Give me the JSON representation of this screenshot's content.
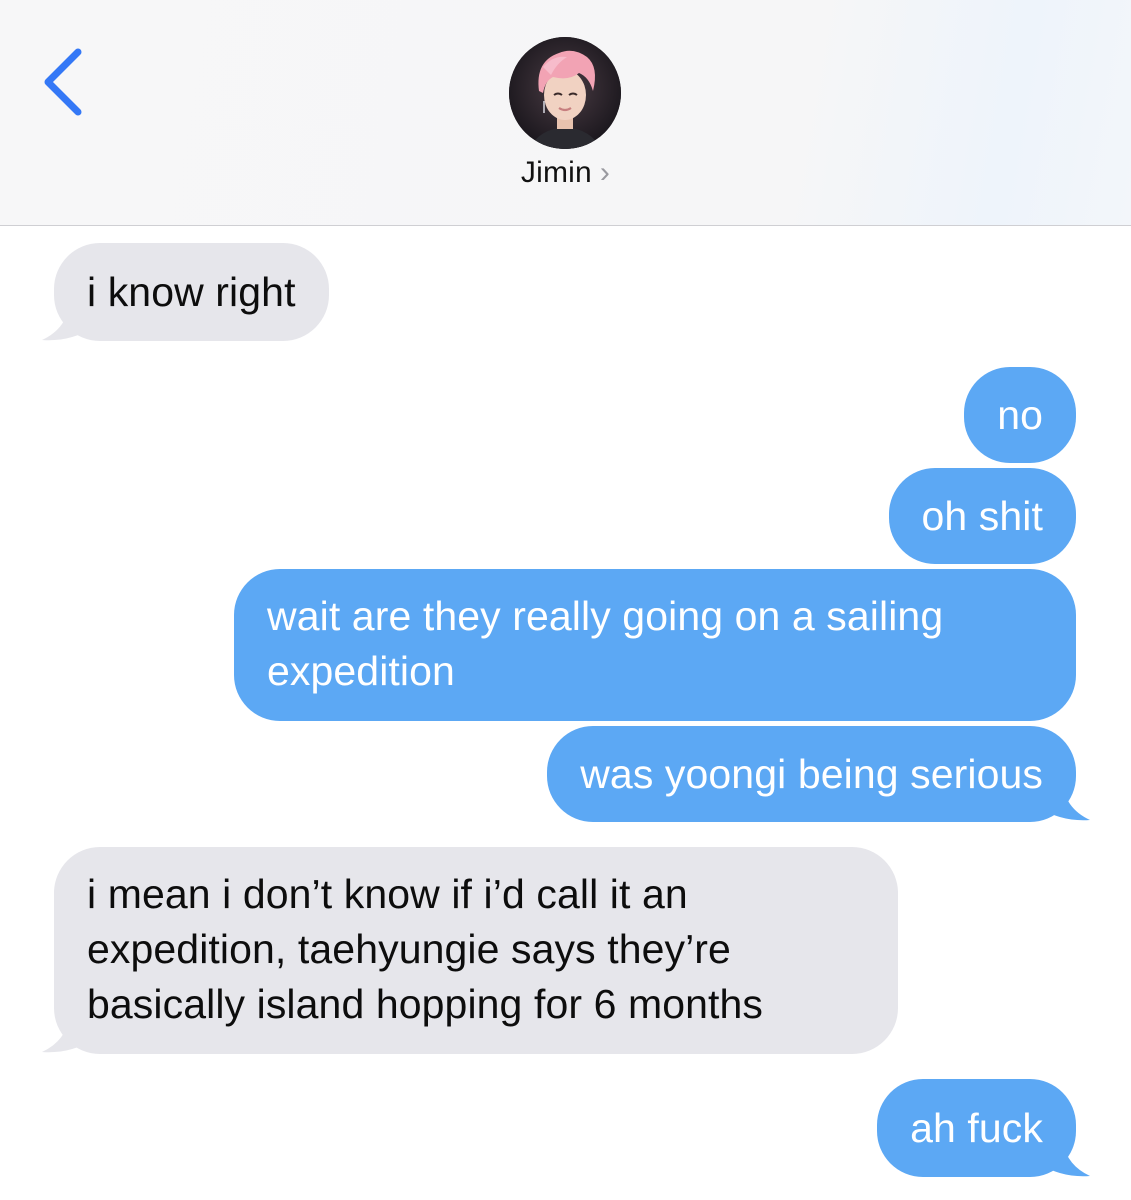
{
  "header": {
    "back_icon": "chevron-left-icon",
    "contact_name": "Jimin",
    "contact_chevron": "›",
    "avatar_icon": "contact-avatar-photo",
    "accent_color": "#3478f6"
  },
  "messages": [
    {
      "from": "contact",
      "text": "i know right"
    },
    {
      "from": "me",
      "text": "no"
    },
    {
      "from": "me",
      "text": "oh shit"
    },
    {
      "from": "me",
      "text": "wait are they really going on a sailing expedition"
    },
    {
      "from": "me",
      "text": "was yoongi being serious"
    },
    {
      "from": "contact",
      "text": "i mean i don’t know if i’d call it an expedition, taehyungie says they’re basically island hopping for 6 months"
    },
    {
      "from": "me",
      "text": "ah fuck"
    }
  ],
  "colors": {
    "incoming_bubble": "#e6e6eb",
    "outgoing_bubble": "#5ca8f4",
    "header_bg": "#f7f7f8"
  }
}
